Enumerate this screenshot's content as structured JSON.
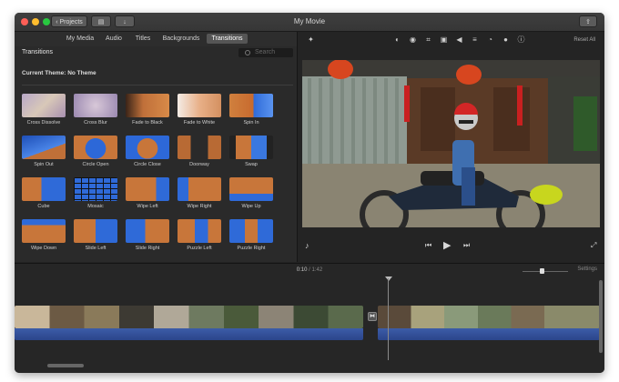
{
  "window": {
    "title": "My Movie",
    "projects_label": "Projects",
    "traffic_lights": [
      "#ff5f57",
      "#febc2e",
      "#28c840"
    ]
  },
  "browser": {
    "tabs": [
      {
        "label": "My Media",
        "active": false
      },
      {
        "label": "Audio",
        "active": false
      },
      {
        "label": "Titles",
        "active": false
      },
      {
        "label": "Backgrounds",
        "active": false
      },
      {
        "label": "Transitions",
        "active": true
      }
    ],
    "section_title": "Transitions",
    "search_placeholder": "Search",
    "current_theme": "Current Theme: No Theme",
    "transitions": [
      {
        "label": "Cross Dissolve",
        "icon": "cross-dissolve"
      },
      {
        "label": "Cross Blur",
        "icon": "cross-blur"
      },
      {
        "label": "Fade to Black",
        "icon": "fade-to-black"
      },
      {
        "label": "Fade to White",
        "icon": "fade-to-white"
      },
      {
        "label": "Spin In",
        "icon": "spin-in"
      },
      {
        "label": "Spin Out",
        "icon": "spin-out"
      },
      {
        "label": "Circle Open",
        "icon": "circle-open"
      },
      {
        "label": "Circle Close",
        "icon": "circle-close"
      },
      {
        "label": "Doorway",
        "icon": "doorway"
      },
      {
        "label": "Swap",
        "icon": "swap"
      },
      {
        "label": "Cube",
        "icon": "cube"
      },
      {
        "label": "Mosaic",
        "icon": "mosaic"
      },
      {
        "label": "Wipe Left",
        "icon": "wipe-left"
      },
      {
        "label": "Wipe Right",
        "icon": "wipe-right"
      },
      {
        "label": "Wipe Up",
        "icon": "wipe-up"
      },
      {
        "label": "Wipe Down",
        "icon": "wipe-down"
      },
      {
        "label": "Slide Left",
        "icon": "slide-left"
      },
      {
        "label": "Slide Right",
        "icon": "slide-right"
      },
      {
        "label": "Puzzle Left",
        "icon": "puzzle-left"
      },
      {
        "label": "Puzzle Right",
        "icon": "puzzle-right"
      }
    ]
  },
  "viewer": {
    "reset_all_label": "Reset All",
    "tools": [
      "color-balance-icon",
      "color-correction-icon",
      "crop-icon",
      "stabilization-icon",
      "volume-icon",
      "noise-reduction-icon",
      "speed-icon",
      "clip-filter-icon",
      "info-icon"
    ]
  },
  "timeline": {
    "current_time": "0:10",
    "separator": "/",
    "total_time": "1:42",
    "settings_label": "Settings",
    "zoom_level": 0.38
  },
  "colors": {
    "window_bg": "#232323",
    "active_tab": "#555555",
    "audio_wave": "#3c5ca8"
  }
}
